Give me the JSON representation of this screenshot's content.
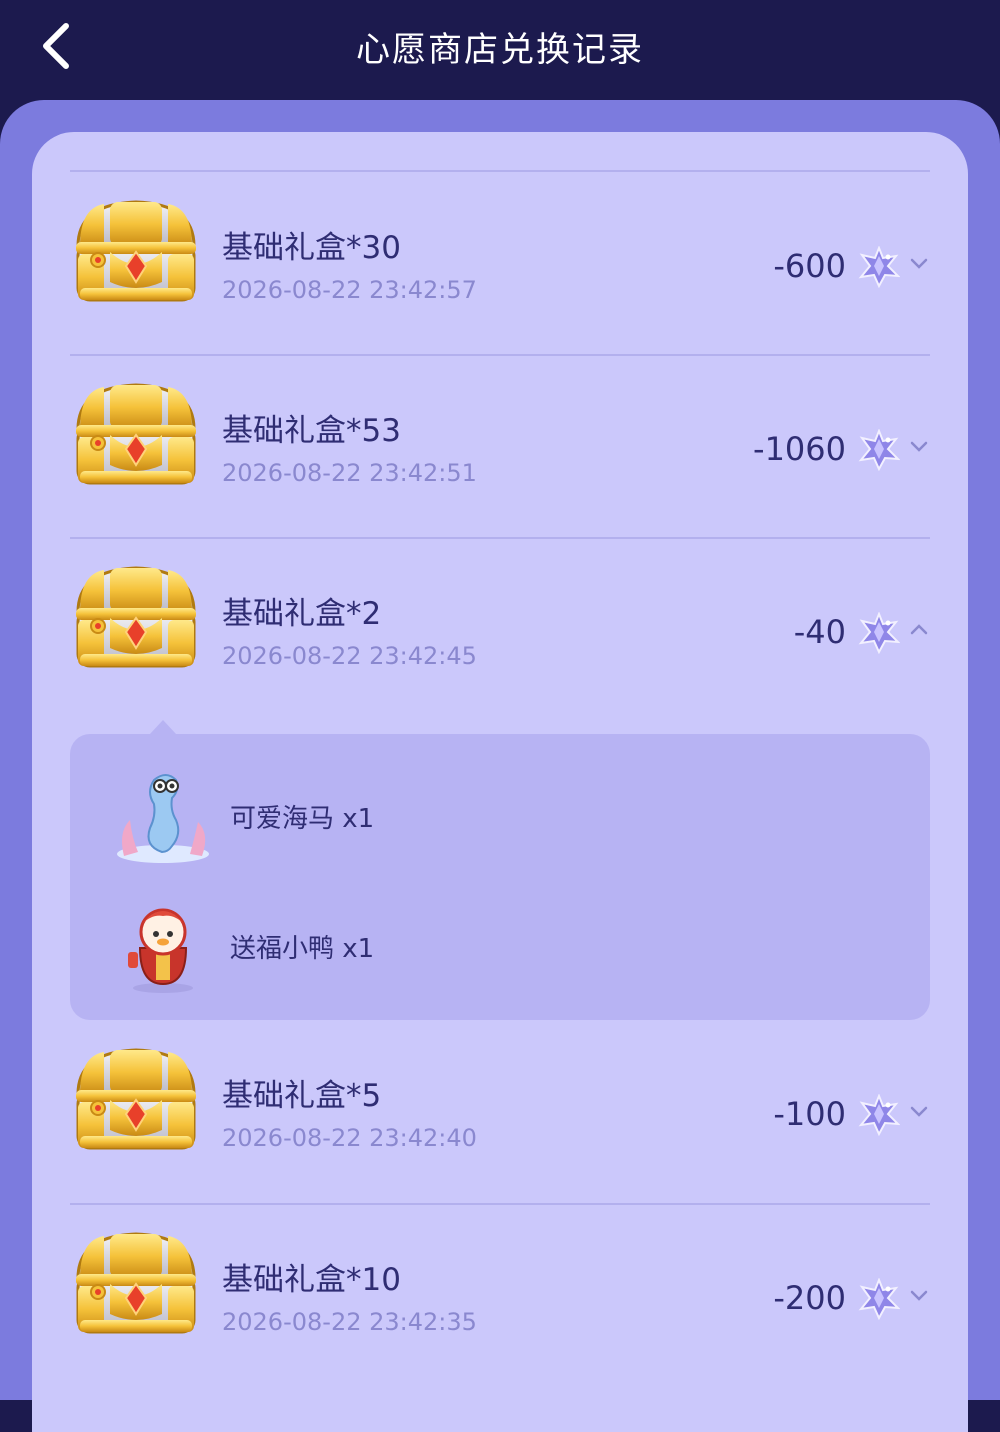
{
  "header": {
    "title": "心愿商店兑换记录"
  },
  "records": [
    {
      "name": "基础礼盒*30",
      "time": "2026-08-22 23:42:57",
      "amount": "-600",
      "expanded": false
    },
    {
      "name": "基础礼盒*53",
      "time": "2026-08-22 23:42:51",
      "amount": "-1060",
      "expanded": false
    },
    {
      "name": "基础礼盒*2",
      "time": "2026-08-22 23:42:45",
      "amount": "-40",
      "expanded": true
    },
    {
      "name": "基础礼盒*5",
      "time": "2026-08-22 23:42:40",
      "amount": "-100",
      "expanded": false
    },
    {
      "name": "基础礼盒*10",
      "time": "2026-08-22 23:42:35",
      "amount": "-200",
      "expanded": false
    }
  ],
  "detail_items": [
    {
      "label": "可爱海马 x1",
      "icon": "seahorse-icon"
    },
    {
      "label": "送福小鸭 x1",
      "icon": "duck-icon"
    }
  ],
  "colors": {
    "header_bg": "#1c1a4e",
    "outer_bg": "#7c7bde",
    "card_bg": "#cbc8fb",
    "detail_bg": "#b7b3f3",
    "text": "#2f2d73",
    "muted_text": "#8a88cf"
  }
}
